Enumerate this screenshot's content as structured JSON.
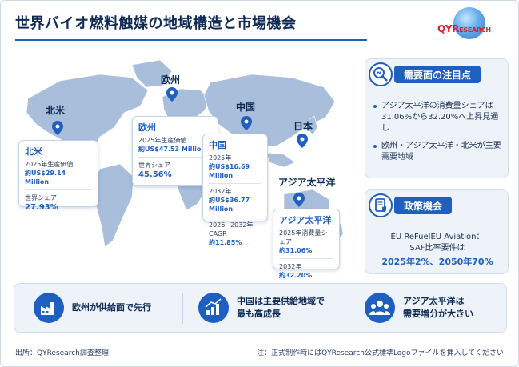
{
  "header": {
    "title": "世界バイオ燃料触媒の地域構造と市場機会",
    "logo_text_a": "QYR",
    "logo_text_b": "ESEARCH"
  },
  "map": {
    "labels": {
      "north_america": "北米",
      "europe": "欧州",
      "china": "中国",
      "japan": "日本",
      "asia_pacific": "アジア太平洋"
    },
    "cards": {
      "north_america": {
        "title": "北米",
        "line1": "2025年生産価値",
        "value1": "約US$29.14 Million",
        "line2": "世界シェア",
        "value2": "27.93%"
      },
      "europe": {
        "title": "欧州",
        "line1": "2025年生産価値",
        "value1": "約US$47.53 Million",
        "line2": "世界シェア",
        "value2": "45.56%"
      },
      "china": {
        "title": "中国",
        "line1": "2025年",
        "value1": "約US$16.69 Million",
        "line2": "2032年",
        "value2": "約US$36.77 Million",
        "line3": "2026−2032年CAGR",
        "value3": "約11.85%"
      },
      "asia_pacific": {
        "title": "アジア太平洋",
        "line1": "2025年消費量シェア",
        "value1": "約31.06%",
        "line2": "2032年",
        "value2": "約32.20%"
      }
    }
  },
  "demand_panel": {
    "heading": "需要面の注目点",
    "bullets": [
      "アジア太平洋の消費量シェアは31.06%から32.20%へ上昇見通し",
      "欧州・アジア太平洋・北米が主要需要地域"
    ]
  },
  "policy_panel": {
    "heading": "政策機会",
    "line1": "EU ReFuelEU Aviation：",
    "line2": "SAF比率要件は",
    "highlight": "2025年2%、2050年70%"
  },
  "features": [
    {
      "line1": "欧州が供給面で先行",
      "line2": ""
    },
    {
      "line1": "中国は主要供給地域で",
      "line2": "最も高成長"
    },
    {
      "line1": "アジア太平洋は",
      "line2": "需要増分が大きい"
    }
  ],
  "footer": {
    "source": "出所：QYResearch調査整理",
    "note": "注：正式制作時にはQYResearch公式標準Logoファイルを挿入してください"
  },
  "colors": {
    "accent": "#1f5fbf",
    "title": "#0f2a55",
    "map": "#9fb6d4",
    "logo_red": "#d6262d"
  }
}
